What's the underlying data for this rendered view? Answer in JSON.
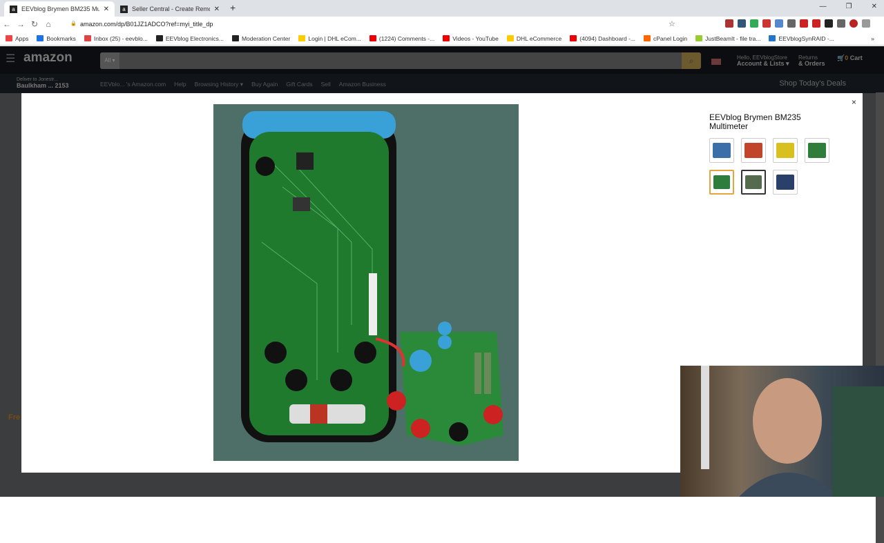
{
  "browser": {
    "tabs": [
      {
        "title": "EEVblog Brymen BM235 Multime",
        "active": true
      },
      {
        "title": "Seller Central - Create Removal O",
        "active": false
      }
    ],
    "url": "amazon.com/dp/B01JZ1ADCO?ref=myi_title_dp",
    "bookmarks": [
      {
        "label": "Apps",
        "color": "#e44"
      },
      {
        "label": "Bookmarks",
        "color": "#1a73e8"
      },
      {
        "label": "Inbox (25) - eevblo...",
        "color": "#d44"
      },
      {
        "label": "EEVblog Electronics...",
        "color": "#222"
      },
      {
        "label": "Moderation Center",
        "color": "#222"
      },
      {
        "label": "Login | DHL eCom...",
        "color": "#fc0"
      },
      {
        "label": "(1224) Comments -...",
        "color": "#e00"
      },
      {
        "label": "Videos - YouTube",
        "color": "#e00"
      },
      {
        "label": "DHL eCommerce",
        "color": "#fc0"
      },
      {
        "label": "(4094) Dashboard -...",
        "color": "#e00"
      },
      {
        "label": "cPanel Login",
        "color": "#f60"
      },
      {
        "label": "JustBeamIt - file tra...",
        "color": "#9c3"
      },
      {
        "label": "EEVblogSynRAID -...",
        "color": "#27c"
      }
    ],
    "more": "»"
  },
  "amazon": {
    "logo": "amazon",
    "search_category": "All ▾",
    "greeting": "Hello, EEVblogStore",
    "account": "Account & Lists ▾",
    "returns": "Returns",
    "orders": "& Orders",
    "cart_count": "0",
    "cart": "Cart",
    "deliver_to": "Deliver to Jonestr...",
    "location": "Baulkham ... 2153",
    "nav": [
      "EEVblo... 's Amazon.com",
      "Help",
      "Browsing History ▾",
      "Buy Again",
      "Gift Cards",
      "Sell",
      "Amazon Business"
    ],
    "deals": "Shop Today's Deals",
    "behind_text": "Fre"
  },
  "modal": {
    "title": "EEVblog Brymen BM235 Multimeter",
    "close": "×",
    "thumbnails": [
      {
        "color": "#3a6fa8",
        "state": ""
      },
      {
        "color": "#c0452a",
        "state": ""
      },
      {
        "color": "#d8c020",
        "state": ""
      },
      {
        "color": "#2e7d3a",
        "state": ""
      },
      {
        "color": "#2e7d3a",
        "state": "selected"
      },
      {
        "color": "#556b4e",
        "state": "hover"
      },
      {
        "color": "#2a3f6a",
        "state": ""
      }
    ]
  }
}
